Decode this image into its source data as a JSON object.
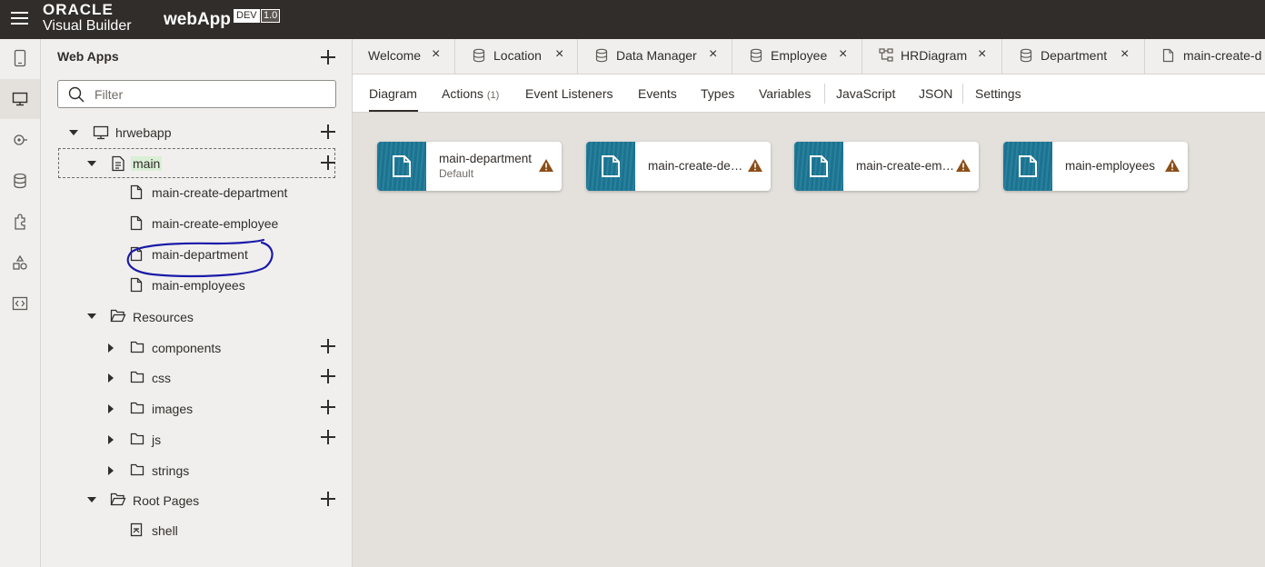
{
  "header": {
    "brand_top": "ORACLE",
    "brand_bottom": "Visual Builder",
    "app_name": "webApp",
    "env_badge": "DEV",
    "version_badge": "1.0"
  },
  "rail": {
    "items": [
      {
        "icon": "mobile-apps-icon"
      },
      {
        "icon": "web-apps-icon"
      },
      {
        "icon": "services-icon"
      },
      {
        "icon": "business-objects-icon"
      },
      {
        "icon": "components-icon"
      },
      {
        "icon": "layouts-icon"
      },
      {
        "icon": "source-icon"
      }
    ]
  },
  "navigator": {
    "title": "Web Apps",
    "filter_placeholder": "Filter",
    "tree": {
      "app": "hrwebapp",
      "flow": "main",
      "pages": [
        "main-create-department",
        "main-create-employee",
        "main-department",
        "main-employees"
      ],
      "resources_label": "Resources",
      "resources": [
        "components",
        "css",
        "images",
        "js",
        "strings"
      ],
      "root_pages_label": "Root Pages",
      "root_pages": [
        "shell"
      ]
    }
  },
  "tabs": [
    {
      "label": "Welcome",
      "icon": ""
    },
    {
      "label": "Location",
      "icon": "database-icon"
    },
    {
      "label": "Data Manager",
      "icon": "database-icon"
    },
    {
      "label": "Employee",
      "icon": "database-icon"
    },
    {
      "label": "HRDiagram",
      "icon": "diagram-icon"
    },
    {
      "label": "Department",
      "icon": "database-icon"
    },
    {
      "label": "main-create-d",
      "icon": "page-icon"
    }
  ],
  "subtabs": {
    "diagram": "Diagram",
    "actions": "Actions",
    "actions_count": "(1)",
    "event_listeners": "Event Listeners",
    "events": "Events",
    "types": "Types",
    "variables": "Variables",
    "javascript": "JavaScript",
    "json": "JSON",
    "settings": "Settings"
  },
  "cards": [
    {
      "title": "main-department",
      "subtitle": "Default"
    },
    {
      "title": "main-create-de…",
      "subtitle": ""
    },
    {
      "title": "main-create-em…",
      "subtitle": ""
    },
    {
      "title": "main-employees",
      "subtitle": ""
    }
  ],
  "colors": {
    "topbar": "#312d2a",
    "card_thumb": "#1e7a99",
    "warning": "#8a4e19",
    "annotation": "#1a1aa8"
  }
}
